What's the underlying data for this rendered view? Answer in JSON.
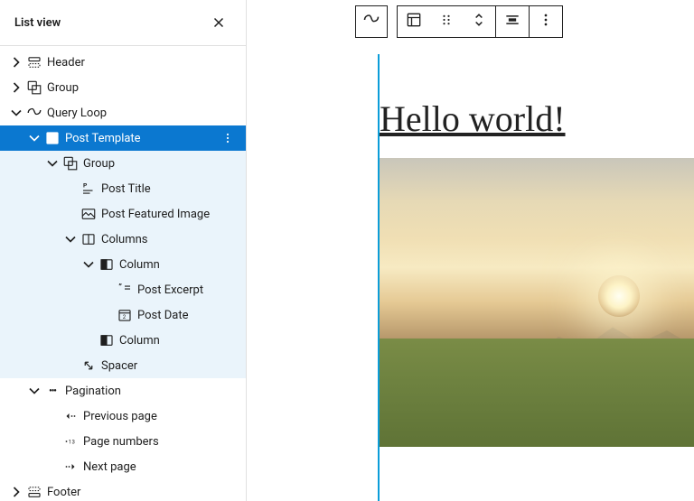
{
  "panel_title": "List view",
  "selected_more": "⋮",
  "tree": {
    "header": "Header",
    "group": "Group",
    "queryLoop": "Query Loop",
    "postTemplate": "Post Template",
    "ptGroup": "Group",
    "postTitle": "Post Title",
    "postFeatured": "Post Featured Image",
    "columns": "Columns",
    "column1": "Column",
    "postExcerpt": "Post Excerpt",
    "postDate": "Post Date",
    "column2": "Column",
    "spacer": "Spacer",
    "pagination": "Pagination",
    "prev": "Previous page",
    "pageNumbers": "Page numbers",
    "next": "Next page",
    "footer": "Footer"
  },
  "post_title": "Hello world!"
}
